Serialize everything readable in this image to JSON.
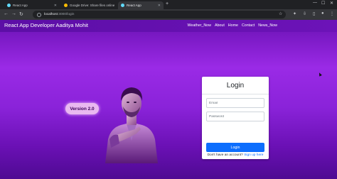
{
  "browser": {
    "tabs": [
      {
        "title": "React App",
        "favicon_color": "#61dafb",
        "active": false
      },
      {
        "title": "Google Drive: Share files online",
        "favicon_color": "#fbbc04",
        "active": false
      },
      {
        "title": "React App",
        "favicon_color": "#61dafb",
        "active": true
      }
    ],
    "new_tab_label": "+",
    "url_host": "localhost",
    "url_path": ":3000/login"
  },
  "app": {
    "brand": "React App Developer Aaditya Mohit",
    "nav": [
      "Weather_Now",
      "About",
      "Home",
      "Contact",
      "News_Now"
    ],
    "version_badge": "Version 2.0"
  },
  "login": {
    "title": "Login",
    "email_placeholder": "Email",
    "password_placeholder": "Password",
    "button_label": "Login",
    "signup_prompt": "Don't have an account?",
    "signup_link": "Sign up here"
  },
  "colors": {
    "navbar": "#5c0ea6",
    "page_gradient_top": "#6a11b3",
    "page_gradient_mid": "#9a2ae6",
    "button": "#0d6efd",
    "badge": "#e9b8f0"
  }
}
